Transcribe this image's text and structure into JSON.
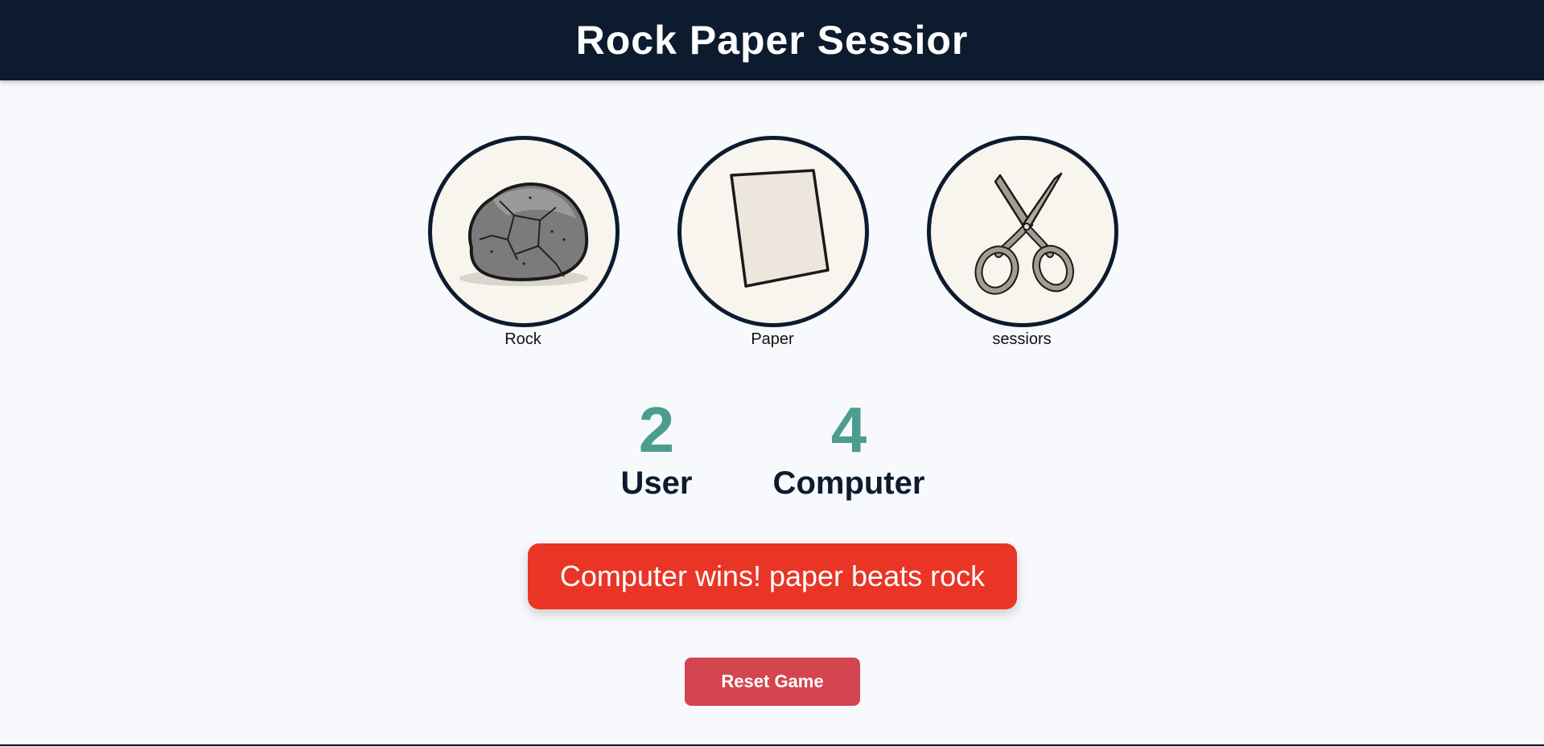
{
  "header": {
    "title": "Rock Paper Sessior"
  },
  "choices": [
    {
      "label": "Rock",
      "icon": "rock-icon"
    },
    {
      "label": "Paper",
      "icon": "paper-icon"
    },
    {
      "label": "sessiors",
      "icon": "scissors-icon"
    }
  ],
  "scores": {
    "user": {
      "value": "2",
      "label": "User"
    },
    "computer": {
      "value": "4",
      "label": "Computer"
    }
  },
  "result": {
    "message": "Computer wins! paper beats rock"
  },
  "reset": {
    "label": "Reset Game"
  },
  "colors": {
    "header_bg": "#0d1b2f",
    "score_accent": "#4a9d8f",
    "result_bg": "#e93426",
    "reset_bg": "#d3454f"
  }
}
